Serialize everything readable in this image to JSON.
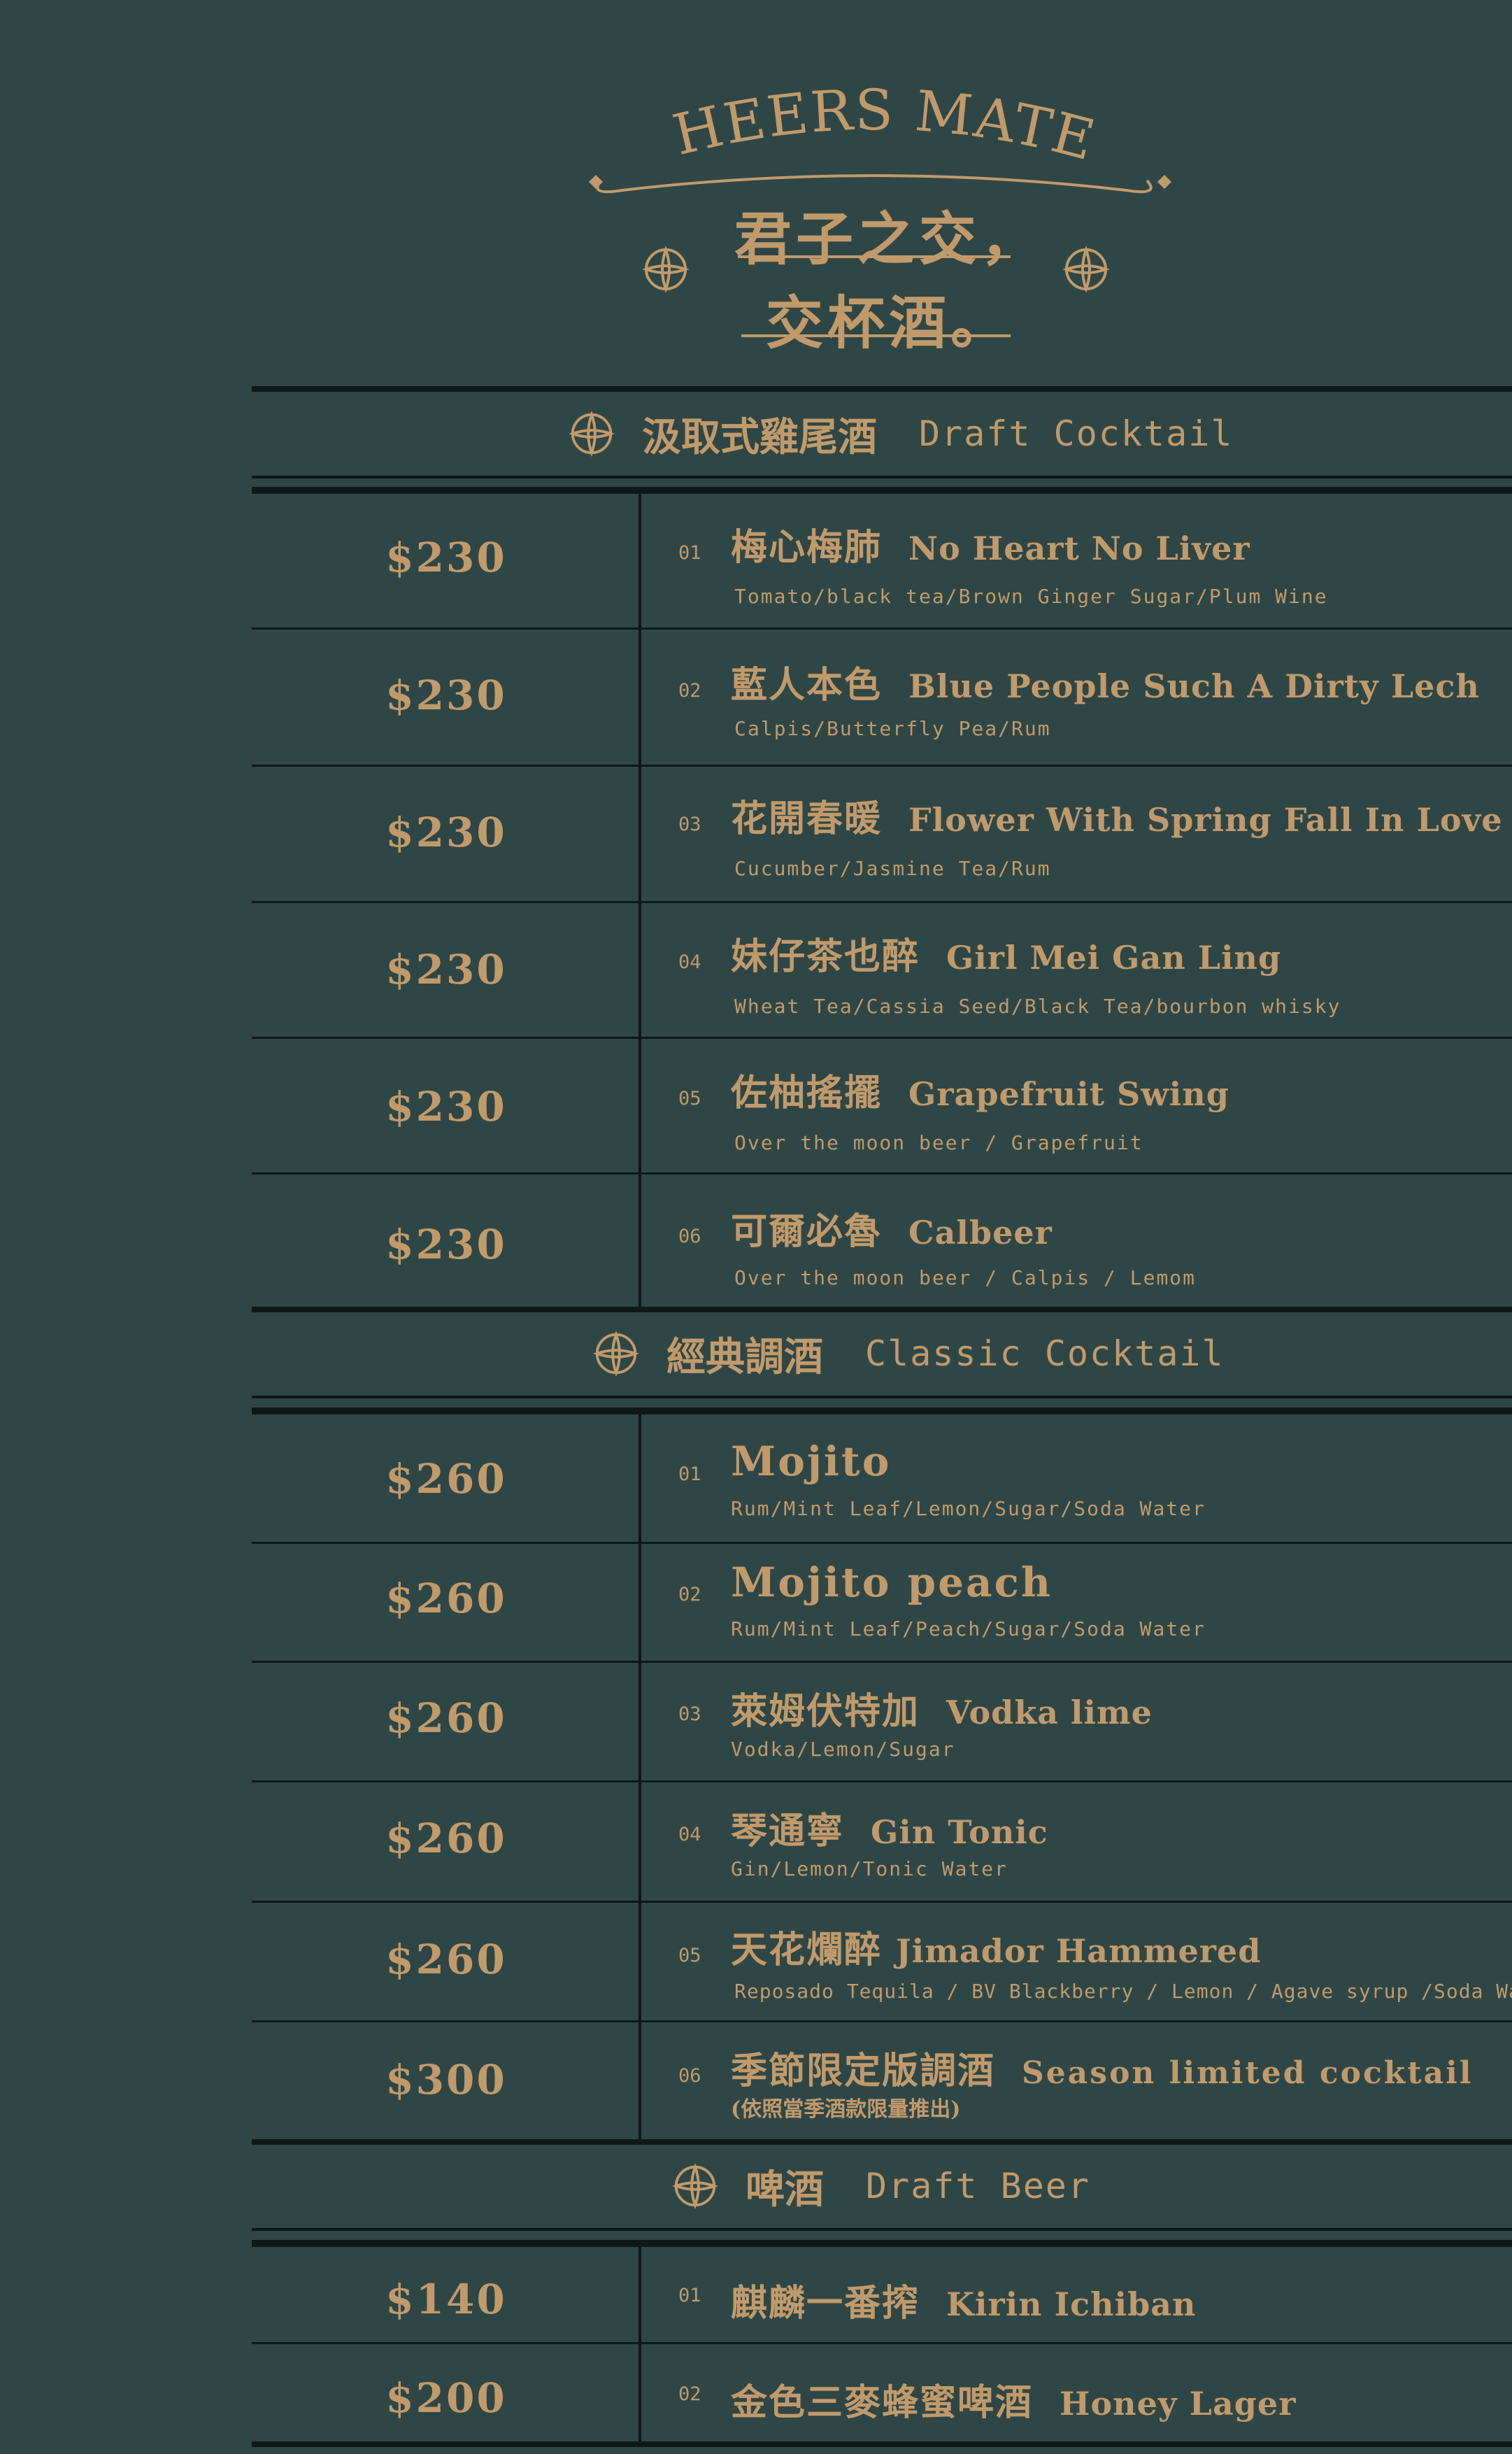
{
  "header": {
    "cheers": "CHEERS MATE!",
    "line1": "君子之交，",
    "line2": "交杯酒。"
  },
  "sections": [
    {
      "cn": "汲取式雞尾酒",
      "en": "Draft Cocktail",
      "items": [
        {
          "price": "$230",
          "num": "01",
          "cn": "梅心梅肺",
          "en": "No Heart No Liver",
          "desc": "Tomato/black tea/Brown Ginger Sugar/Plum Wine"
        },
        {
          "price": "$230",
          "num": "02",
          "cn": "藍人本色",
          "en": "Blue People Such A Dirty Lech",
          "desc": "Calpis/Butterfly Pea/Rum"
        },
        {
          "price": "$230",
          "num": "03",
          "cn": "花開春暖",
          "en": "Flower With Spring Fall In Love",
          "desc": "Cucumber/Jasmine Tea/Rum"
        },
        {
          "price": "$230",
          "num": "04",
          "cn": "妹仔茶也醉",
          "en": "Girl Mei Gan Ling",
          "desc": "Wheat Tea/Cassia Seed/Black Tea/bourbon whisky"
        },
        {
          "price": "$230",
          "num": "05",
          "cn": "佐柚搖擺",
          "en": "Grapefruit Swing",
          "desc": "Over the moon beer / Grapefruit"
        },
        {
          "price": "$230",
          "num": "06",
          "cn": "可爾必魯",
          "en": "Calbeer",
          "desc": "Over the moon beer / Calpis / Lemom"
        }
      ]
    },
    {
      "cn": "經典調酒",
      "en": "Classic Cocktail",
      "items": [
        {
          "price": "$260",
          "num": "01",
          "cn": "",
          "en": "Mojito",
          "desc": "Rum/Mint Leaf/Lemon/Sugar/Soda Water"
        },
        {
          "price": "$260",
          "num": "02",
          "cn": "",
          "en": "Mojito peach",
          "desc": "Rum/Mint Leaf/Peach/Sugar/Soda Water"
        },
        {
          "price": "$260",
          "num": "03",
          "cn": "萊姆伏特加",
          "en": "Vodka lime",
          "desc": "Vodka/Lemon/Sugar"
        },
        {
          "price": "$260",
          "num": "04",
          "cn": "琴通寧",
          "en": "Gin Tonic",
          "desc": "Gin/Lemon/Tonic Water"
        },
        {
          "price": "$260",
          "num": "05",
          "cn": "天花爛醉",
          "en": "Jimador Hammered",
          "desc": "Reposado Tequila / BV Blackberry / Lemon / Agave syrup /Soda Water"
        },
        {
          "price": "$300",
          "num": "06",
          "cn": "季節限定版調酒",
          "en": "Season limited cocktail",
          "note": "(依照當季酒款限量推出)"
        }
      ]
    },
    {
      "cn": "啤酒",
      "en": "Draft Beer",
      "items": [
        {
          "price": "$140",
          "num": "01",
          "cn": "麒麟一番搾",
          "en": "Kirin Ichiban"
        },
        {
          "price": "$200",
          "num": "02",
          "cn": "金色三麥蜂蜜啤酒",
          "en": "Honey Lager"
        }
      ]
    }
  ],
  "colors": {
    "background": "#2f4646",
    "gold": "#c19a6b",
    "rule": "#0f1717"
  },
  "icons": {
    "section": "compass-ornament-icon",
    "header": "diamond-ornament-icon"
  }
}
